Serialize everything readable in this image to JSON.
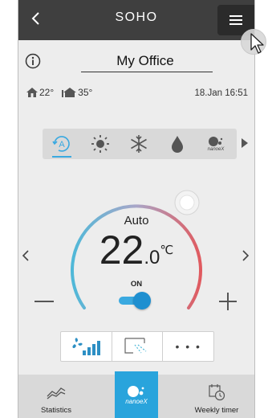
{
  "header": {
    "title": "SOHO",
    "back_icon": "chevron-left-icon",
    "menu_icon": "hamburger-menu-icon",
    "background": "#3f3f3f"
  },
  "room": {
    "name": "My Office",
    "info_icon": "info-icon"
  },
  "environment": {
    "indoor_temp": "22°",
    "outdoor_temp": "35°",
    "datetime": "18.Jan 16:51"
  },
  "modes": {
    "items": [
      {
        "name": "auto",
        "icon": "auto-mode-icon",
        "selected": true
      },
      {
        "name": "heat",
        "icon": "sun-icon",
        "selected": false
      },
      {
        "name": "cool",
        "icon": "snowflake-icon",
        "selected": false
      },
      {
        "name": "dry",
        "icon": "drop-icon",
        "selected": false
      },
      {
        "name": "nanoe",
        "icon": "nanoe-x-icon",
        "label": "nanoeX",
        "selected": false
      }
    ],
    "accent": "#3aa9e0"
  },
  "dial": {
    "mode_label": "Auto",
    "temp_whole": "22",
    "temp_decimal": ".0",
    "unit": "℃",
    "setpoint_fraction": 0.62,
    "cool_color": "#4fb8d8",
    "warm_color": "#e05a5f"
  },
  "power": {
    "label": "ON",
    "state": true,
    "color": "#1e8fd0"
  },
  "sub_controls": {
    "fan_icon": "fan-speed-icon",
    "airflow_icon": "airflow-direction-icon",
    "more_label": "• • •"
  },
  "footer": {
    "statistics_label": "Statistics",
    "nanoe_label": "nanoeX",
    "weekly_timer_label": "Weekly timer",
    "nanoe_color": "#29a4dc"
  }
}
